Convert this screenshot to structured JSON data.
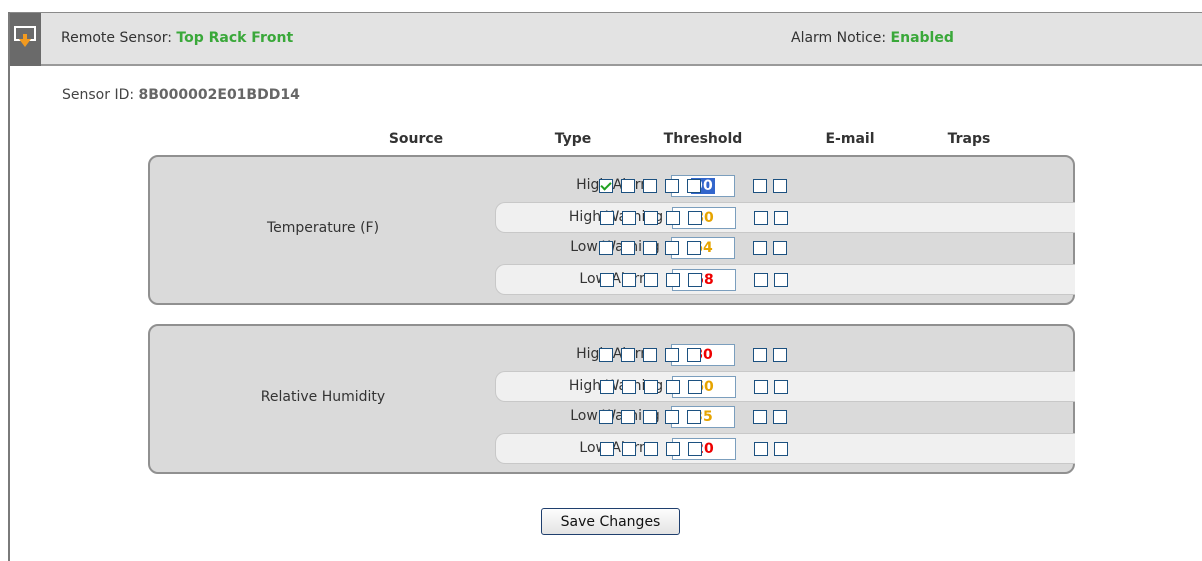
{
  "header": {
    "remote_sensor_label": "Remote Sensor: ",
    "remote_sensor_value": "Top Rack Front",
    "alarm_notice_label": "Alarm Notice: ",
    "alarm_notice_value": "Enabled"
  },
  "sensor": {
    "id_label": "Sensor ID: ",
    "id_value": "8B000002E01BDD14"
  },
  "columns": {
    "source": "Source",
    "type": "Type",
    "threshold": "Threshold",
    "email": "E-mail",
    "traps": "Traps"
  },
  "colors": {
    "alarm": "#ee0000",
    "warning": "#e6a400",
    "selected": "#3366cc",
    "accent_green": "#3aa83a"
  },
  "groups": [
    {
      "source": "Temperature (F)",
      "rows": [
        {
          "type": "High Alarm",
          "threshold": "90",
          "level": "alarm",
          "email": [
            true,
            false,
            false,
            false,
            false
          ],
          "traps": [
            false,
            false
          ]
        },
        {
          "type": "High Warning",
          "threshold": "80",
          "level": "warning",
          "email": [
            false,
            false,
            false,
            false,
            false
          ],
          "traps": [
            false,
            false
          ]
        },
        {
          "type": "Low Warning",
          "threshold": "64",
          "level": "warning",
          "email": [
            false,
            false,
            false,
            false,
            false
          ],
          "traps": [
            false,
            false
          ]
        },
        {
          "type": "Low Alarm",
          "threshold": "58",
          "level": "alarm",
          "email": [
            false,
            false,
            false,
            false,
            false
          ],
          "traps": [
            false,
            false
          ]
        }
      ]
    },
    {
      "source": "Relative Humidity",
      "rows": [
        {
          "type": "High Alarm",
          "threshold": "80",
          "level": "alarm",
          "email": [
            false,
            false,
            false,
            false,
            false
          ],
          "traps": [
            false,
            false
          ]
        },
        {
          "type": "High Warning",
          "threshold": "60",
          "level": "warning",
          "email": [
            false,
            false,
            false,
            false,
            false
          ],
          "traps": [
            false,
            false
          ]
        },
        {
          "type": "Low Warning",
          "threshold": "35",
          "level": "warning",
          "email": [
            false,
            false,
            false,
            false,
            false
          ],
          "traps": [
            false,
            false
          ]
        },
        {
          "type": "Low Alarm",
          "threshold": "20",
          "level": "alarm",
          "email": [
            false,
            false,
            false,
            false,
            false
          ],
          "traps": [
            false,
            false
          ]
        }
      ]
    }
  ],
  "actions": {
    "save_label": "Save Changes"
  }
}
